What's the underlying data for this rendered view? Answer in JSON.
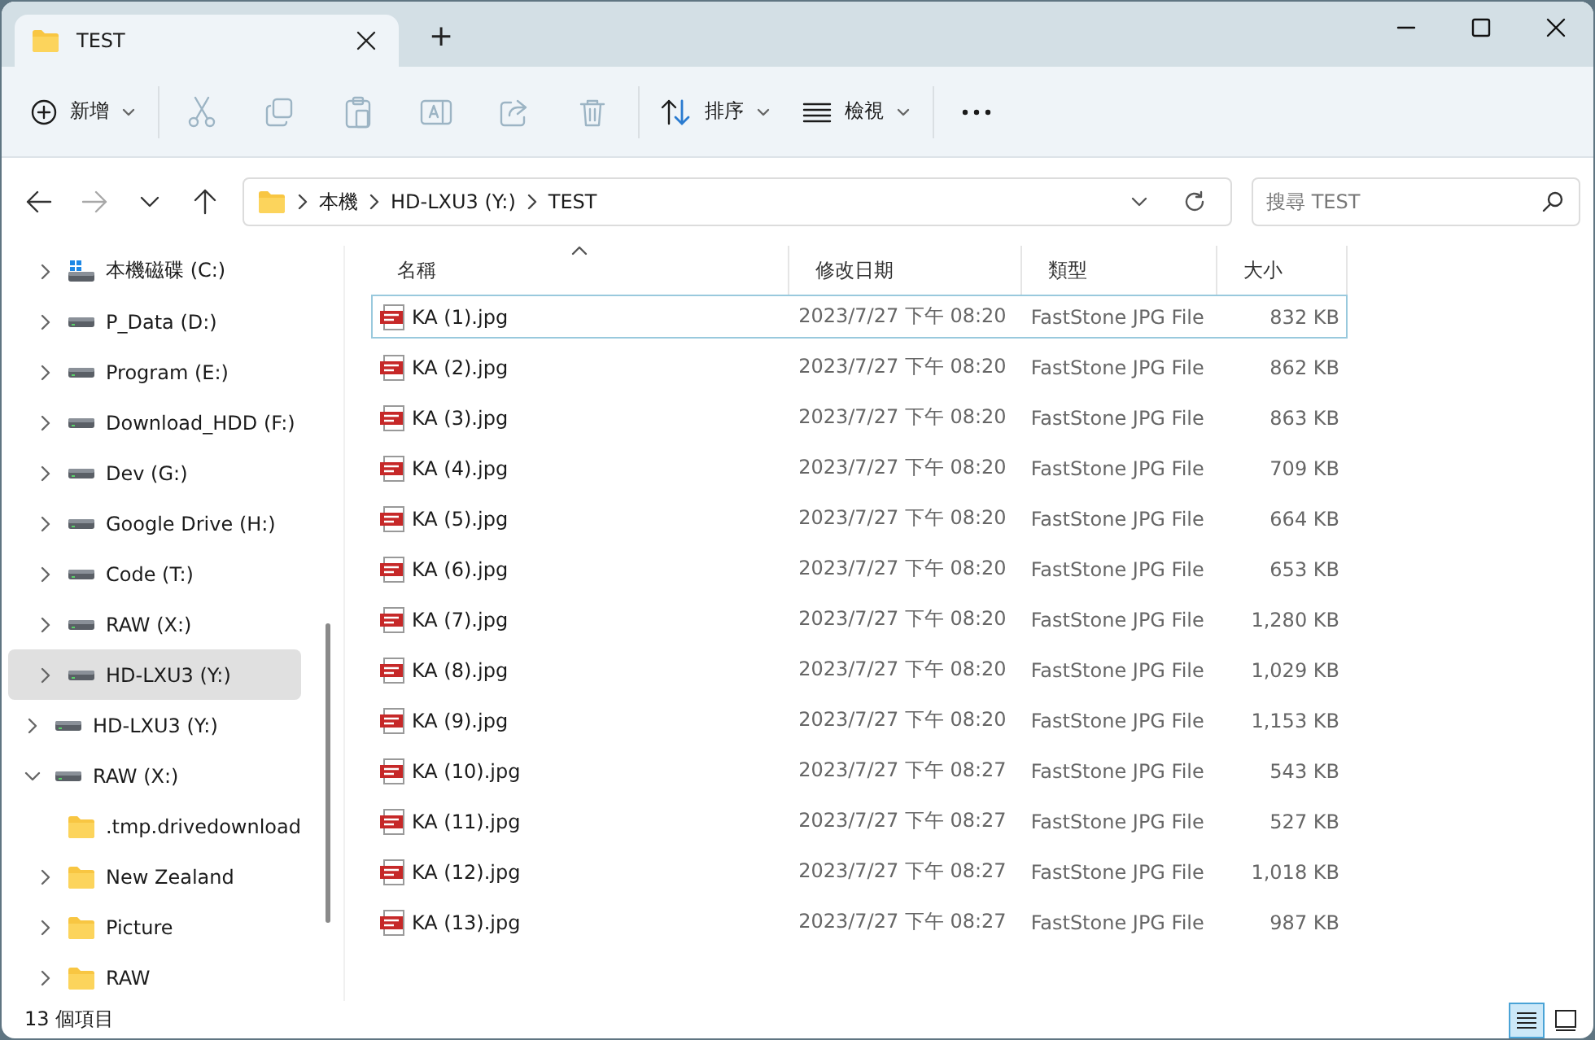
{
  "window": {
    "tab": {
      "title": "TEST"
    },
    "new_tab_label": "+"
  },
  "toolbar": {
    "items": [
      {
        "kind": "new",
        "label": "新增",
        "disabled": false
      },
      {
        "kind": "cut",
        "disabled": true
      },
      {
        "kind": "copy",
        "disabled": true
      },
      {
        "kind": "paste",
        "disabled": true
      },
      {
        "kind": "rename",
        "disabled": true
      },
      {
        "kind": "share",
        "disabled": true
      },
      {
        "kind": "delete",
        "disabled": true
      },
      {
        "kind": "sort",
        "label": "排序",
        "disabled": false
      },
      {
        "kind": "view",
        "label": "檢視",
        "disabled": false
      },
      {
        "kind": "more",
        "disabled": false
      }
    ]
  },
  "nav": {
    "buttons": [
      {
        "kind": "back",
        "disabled": false
      },
      {
        "kind": "forward",
        "disabled": true
      },
      {
        "kind": "recent",
        "disabled": false
      },
      {
        "kind": "up",
        "disabled": false
      }
    ],
    "breadcrumb": [
      "本機",
      "HD-LXU3 (Y:)",
      "TEST"
    ],
    "search": {
      "placeholder": "搜尋 TEST"
    }
  },
  "sidebar": {
    "items": [
      {
        "children": [
          {
            "label": "本機磁碟 (C:)",
            "kind": "system-drive",
            "expandable": true,
            "expanded": false,
            "selected": false
          },
          {
            "label": "P_Data (D:)",
            "kind": "drive",
            "expandable": true,
            "expanded": false,
            "selected": false
          },
          {
            "label": "Program (E:)",
            "kind": "drive",
            "expandable": true,
            "expanded": false,
            "selected": false
          },
          {
            "label": "Download_HDD (F:)",
            "kind": "drive",
            "expandable": true,
            "expanded": false,
            "selected": false
          },
          {
            "label": "Dev (G:)",
            "kind": "drive",
            "expandable": true,
            "expanded": false,
            "selected": false
          },
          {
            "label": "Google Drive (H:)",
            "kind": "drive",
            "expandable": true,
            "expanded": false,
            "selected": false
          },
          {
            "label": "Code (T:)",
            "kind": "drive",
            "expandable": true,
            "expanded": false,
            "selected": false
          },
          {
            "label": "RAW (X:)",
            "kind": "drive",
            "expandable": true,
            "expanded": false,
            "selected": false
          },
          {
            "label": "HD-LXU3 (Y:)",
            "kind": "drive",
            "expandable": true,
            "expanded": false,
            "selected": true
          }
        ]
      },
      {
        "label": "HD-LXU3 (Y:)",
        "kind": "drive",
        "expandable": true,
        "expanded": false,
        "selected": false
      },
      {
        "label": "RAW (X:)",
        "kind": "drive",
        "expandable": true,
        "expanded": true,
        "selected": false,
        "children": [
          {
            "label": ".tmp.drivedownload",
            "kind": "folder",
            "expandable": false,
            "selected": false
          },
          {
            "label": "New Zealand",
            "kind": "folder",
            "expandable": true,
            "expanded": false,
            "selected": false
          },
          {
            "label": "Picture",
            "kind": "folder",
            "expandable": true,
            "expanded": false,
            "selected": false
          },
          {
            "label": "RAW",
            "kind": "folder",
            "expandable": true,
            "expanded": false,
            "selected": false
          }
        ]
      }
    ]
  },
  "table": {
    "columns": [
      {
        "label": "名稱",
        "sorted": true
      },
      {
        "label": "修改日期",
        "sorted": false
      },
      {
        "label": "類型",
        "sorted": false
      },
      {
        "label": "大小",
        "sorted": false
      }
    ],
    "rows": [
      {
        "name": "KA (1).jpg",
        "date": "2023/7/27 下午 08:20",
        "type": "FastStone JPG File",
        "size": "832 KB",
        "focused": true
      },
      {
        "name": "KA (2).jpg",
        "date": "2023/7/27 下午 08:20",
        "type": "FastStone JPG File",
        "size": "862 KB",
        "focused": false
      },
      {
        "name": "KA (3).jpg",
        "date": "2023/7/27 下午 08:20",
        "type": "FastStone JPG File",
        "size": "863 KB",
        "focused": false
      },
      {
        "name": "KA (4).jpg",
        "date": "2023/7/27 下午 08:20",
        "type": "FastStone JPG File",
        "size": "709 KB",
        "focused": false
      },
      {
        "name": "KA (5).jpg",
        "date": "2023/7/27 下午 08:20",
        "type": "FastStone JPG File",
        "size": "664 KB",
        "focused": false
      },
      {
        "name": "KA (6).jpg",
        "date": "2023/7/27 下午 08:20",
        "type": "FastStone JPG File",
        "size": "653 KB",
        "focused": false
      },
      {
        "name": "KA (7).jpg",
        "date": "2023/7/27 下午 08:20",
        "type": "FastStone JPG File",
        "size": "1,280 KB",
        "focused": false
      },
      {
        "name": "KA (8).jpg",
        "date": "2023/7/27 下午 08:20",
        "type": "FastStone JPG File",
        "size": "1,029 KB",
        "focused": false
      },
      {
        "name": "KA (9).jpg",
        "date": "2023/7/27 下午 08:20",
        "type": "FastStone JPG File",
        "size": "1,153 KB",
        "focused": false
      },
      {
        "name": "KA (10).jpg",
        "date": "2023/7/27 下午 08:27",
        "type": "FastStone JPG File",
        "size": "543 KB",
        "focused": false
      },
      {
        "name": "KA (11).jpg",
        "date": "2023/7/27 下午 08:27",
        "type": "FastStone JPG File",
        "size": "527 KB",
        "focused": false
      },
      {
        "name": "KA (12).jpg",
        "date": "2023/7/27 下午 08:27",
        "type": "FastStone JPG File",
        "size": "1,018 KB",
        "focused": false
      },
      {
        "name": "KA (13).jpg",
        "date": "2023/7/27 下午 08:27",
        "type": "FastStone JPG File",
        "size": "987 KB",
        "focused": false
      }
    ]
  },
  "status_bar": {
    "count": "13 個項目",
    "views": [
      {
        "kind": "details",
        "selected": true
      },
      {
        "kind": "tiles",
        "selected": false
      }
    ]
  }
}
